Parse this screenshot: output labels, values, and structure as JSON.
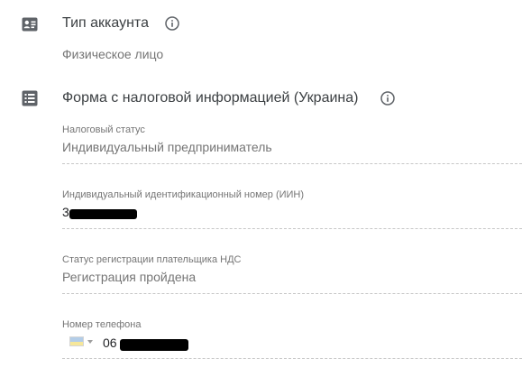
{
  "account_type": {
    "title": "Тип аккаунта",
    "value": "Физическое лицо",
    "icon": "account-card-icon",
    "info_icon": "info-icon"
  },
  "tax_form": {
    "title": "Форма с налоговой информацией (Украина)",
    "icon": "list-icon",
    "info_icon": "info-icon",
    "fields": [
      {
        "label": "Налоговый статус",
        "value": "Индивидуальный предприниматель"
      },
      {
        "label": "Индивидуальный идентификационный номер (ИИН)",
        "value": "3"
      },
      {
        "label": "Статус регистрации плательщика НДС",
        "value": "Регистрация пройдена"
      },
      {
        "label": "Номер телефона",
        "value": "06"
      }
    ]
  },
  "colors": {
    "icon": "#5f6368",
    "label": "#757575",
    "flag_top": "#b3cde8",
    "flag_bottom": "#f6e79a"
  }
}
